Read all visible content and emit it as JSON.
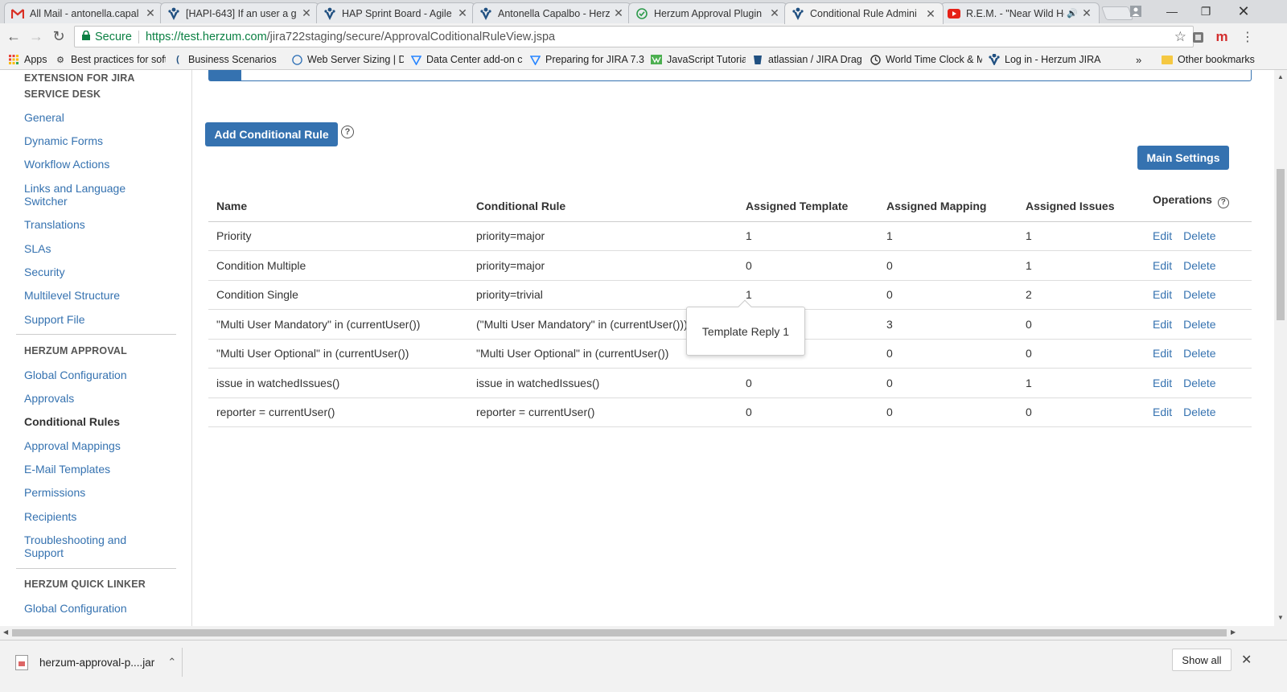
{
  "browser": {
    "tabs": [
      {
        "title": "All Mail - antonella.capal",
        "icon": "gmail-icon"
      },
      {
        "title": "[HAPI-643] If an user a g",
        "icon": "jira-icon"
      },
      {
        "title": "HAP Sprint Board - Agile",
        "icon": "jira-icon"
      },
      {
        "title": "Antonella Capalbo - Herz",
        "icon": "jira-icon"
      },
      {
        "title": "Herzum Approval Plugin",
        "icon": "check-circle-icon"
      },
      {
        "title": "Conditional Rule Admini",
        "icon": "jira-icon",
        "active": true
      },
      {
        "title": "R.E.M. - \"Near Wild He",
        "icon": "youtube-icon",
        "audio": true
      }
    ],
    "secure_label": "Secure",
    "url_host": "https://test.herzum.com",
    "url_path": "/jira722staging/secure/ApprovalCoditionalRuleView.jspa",
    "bookmarks": [
      {
        "label": "Apps",
        "icon": "apps-grid-icon"
      },
      {
        "label": "Best practices for soft",
        "icon": "gear-bookmark-icon"
      },
      {
        "label": "Business Scenarios",
        "icon": "confluence-icon"
      },
      {
        "label": "Web Server Sizing | De",
        "icon": "dell-icon"
      },
      {
        "label": "Data Center add-on c",
        "icon": "atlassian-icon"
      },
      {
        "label": "Preparing for JIRA 7.3",
        "icon": "atlassian-icon"
      },
      {
        "label": "JavaScript Tutorial",
        "icon": "w3-icon"
      },
      {
        "label": "atlassian / JIRA Drag &",
        "icon": "bitbucket-icon"
      },
      {
        "label": "World Time Clock & M",
        "icon": "clock-icon"
      },
      {
        "label": "Log in - Herzum JIRA",
        "icon": "jira-icon"
      }
    ],
    "more_bookmarks": "»",
    "other_bookmarks": "Other bookmarks"
  },
  "sidebar": {
    "section1_heading_line1": "EXTENSION FOR JIRA",
    "section1_heading_line2": "SERVICE DESK",
    "section1_items": [
      "General",
      "Dynamic Forms",
      "Workflow Actions",
      "Links and Language Switcher",
      "Translations",
      "SLAs",
      "Security",
      "Multilevel Structure",
      "Support File"
    ],
    "section2_heading": "HERZUM APPROVAL",
    "section2_items": [
      "Global Configuration",
      "Approvals",
      "Conditional Rules",
      "Approval Mappings",
      "E-Mail Templates",
      "Permissions",
      "Recipients",
      "Troubleshooting and Support"
    ],
    "section3_heading": "HERZUM QUICK LINKER",
    "section3_items": [
      "Global Configuration"
    ]
  },
  "main": {
    "add_button": "Add Conditional Rule",
    "main_settings_button": "Main Settings",
    "help_glyph": "?",
    "columns": [
      "Name",
      "Conditional Rule",
      "Assigned Template",
      "Assigned Mapping",
      "Assigned Issues",
      "Operations"
    ],
    "rows": [
      {
        "name": "Priority",
        "rule": "priority=major",
        "template": "1",
        "mapping": "1",
        "issues": "1"
      },
      {
        "name": "Condition Multiple",
        "rule": "priority=major",
        "template": "0",
        "mapping": "0",
        "issues": "1"
      },
      {
        "name": "Condition Single",
        "rule": "priority=trivial",
        "template": "1",
        "mapping": "0",
        "issues": "2"
      },
      {
        "name": "\"Multi User Mandatory\" in (currentUser())",
        "rule": "(\"Multi User Mandatory\" in (currentUser()))",
        "template": "",
        "mapping": "3",
        "issues": "0"
      },
      {
        "name": "\"Multi User Optional\" in (currentUser())",
        "rule": "\"Multi User Optional\" in (currentUser())",
        "template": "",
        "mapping": "0",
        "issues": "0"
      },
      {
        "name": "issue in watchedIssues()",
        "rule": "issue in watchedIssues()",
        "template": "0",
        "mapping": "0",
        "issues": "1"
      },
      {
        "name": "reporter = currentUser()",
        "rule": "reporter = currentUser()",
        "template": "0",
        "mapping": "0",
        "issues": "0"
      }
    ],
    "edit_label": "Edit",
    "delete_label": "Delete",
    "tooltip": "Template Reply 1"
  },
  "download_shelf": {
    "file_name": "herzum-approval-p....jar",
    "show_all": "Show all"
  },
  "colors": {
    "link": "#3572b0",
    "count_link": "#1c16d4",
    "primary_button": "#3572b0"
  }
}
